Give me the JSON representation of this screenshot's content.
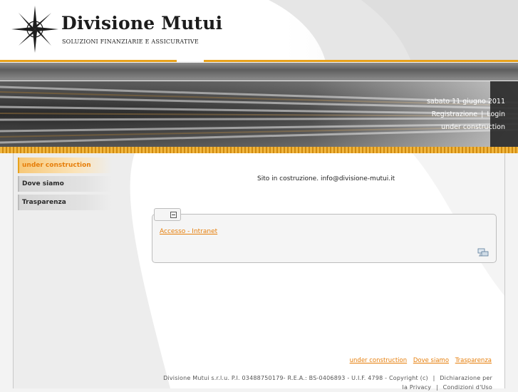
{
  "header": {
    "brand_title": "Divisione Mutui",
    "brand_subtitle": "SOLUZIONI FINANZIARIE E ASSICURATIVE"
  },
  "banner": {
    "date": "sabato 11 giugno 2011",
    "register_label": "Registrazione",
    "separator": "|",
    "login_label": "Login",
    "status": "under construction"
  },
  "sidebar": {
    "items": [
      {
        "label": "under construction"
      },
      {
        "label": "Dove siamo"
      },
      {
        "label": "Trasparenza"
      }
    ]
  },
  "main": {
    "notice": "Sito in costruzione. info@divisione-mutui.it",
    "module": {
      "link_label": "Accesso - Intranet"
    }
  },
  "footer": {
    "links": [
      "under construction",
      "Dove siamo",
      "Trasparenza"
    ],
    "copyright": "Divisione Mutui s.r.l.u. P.I. 03488750179- R.E.A.: BS-0406893 - U.I.F. 4798 - Copyright (c)",
    "separator": "|",
    "privacy_label": "Dichiarazione per la Privacy",
    "separator2": "|",
    "terms_label": "Condizioni d'Uso"
  },
  "colors": {
    "accent": "#e67e0a",
    "gold": "#e8a21c"
  }
}
